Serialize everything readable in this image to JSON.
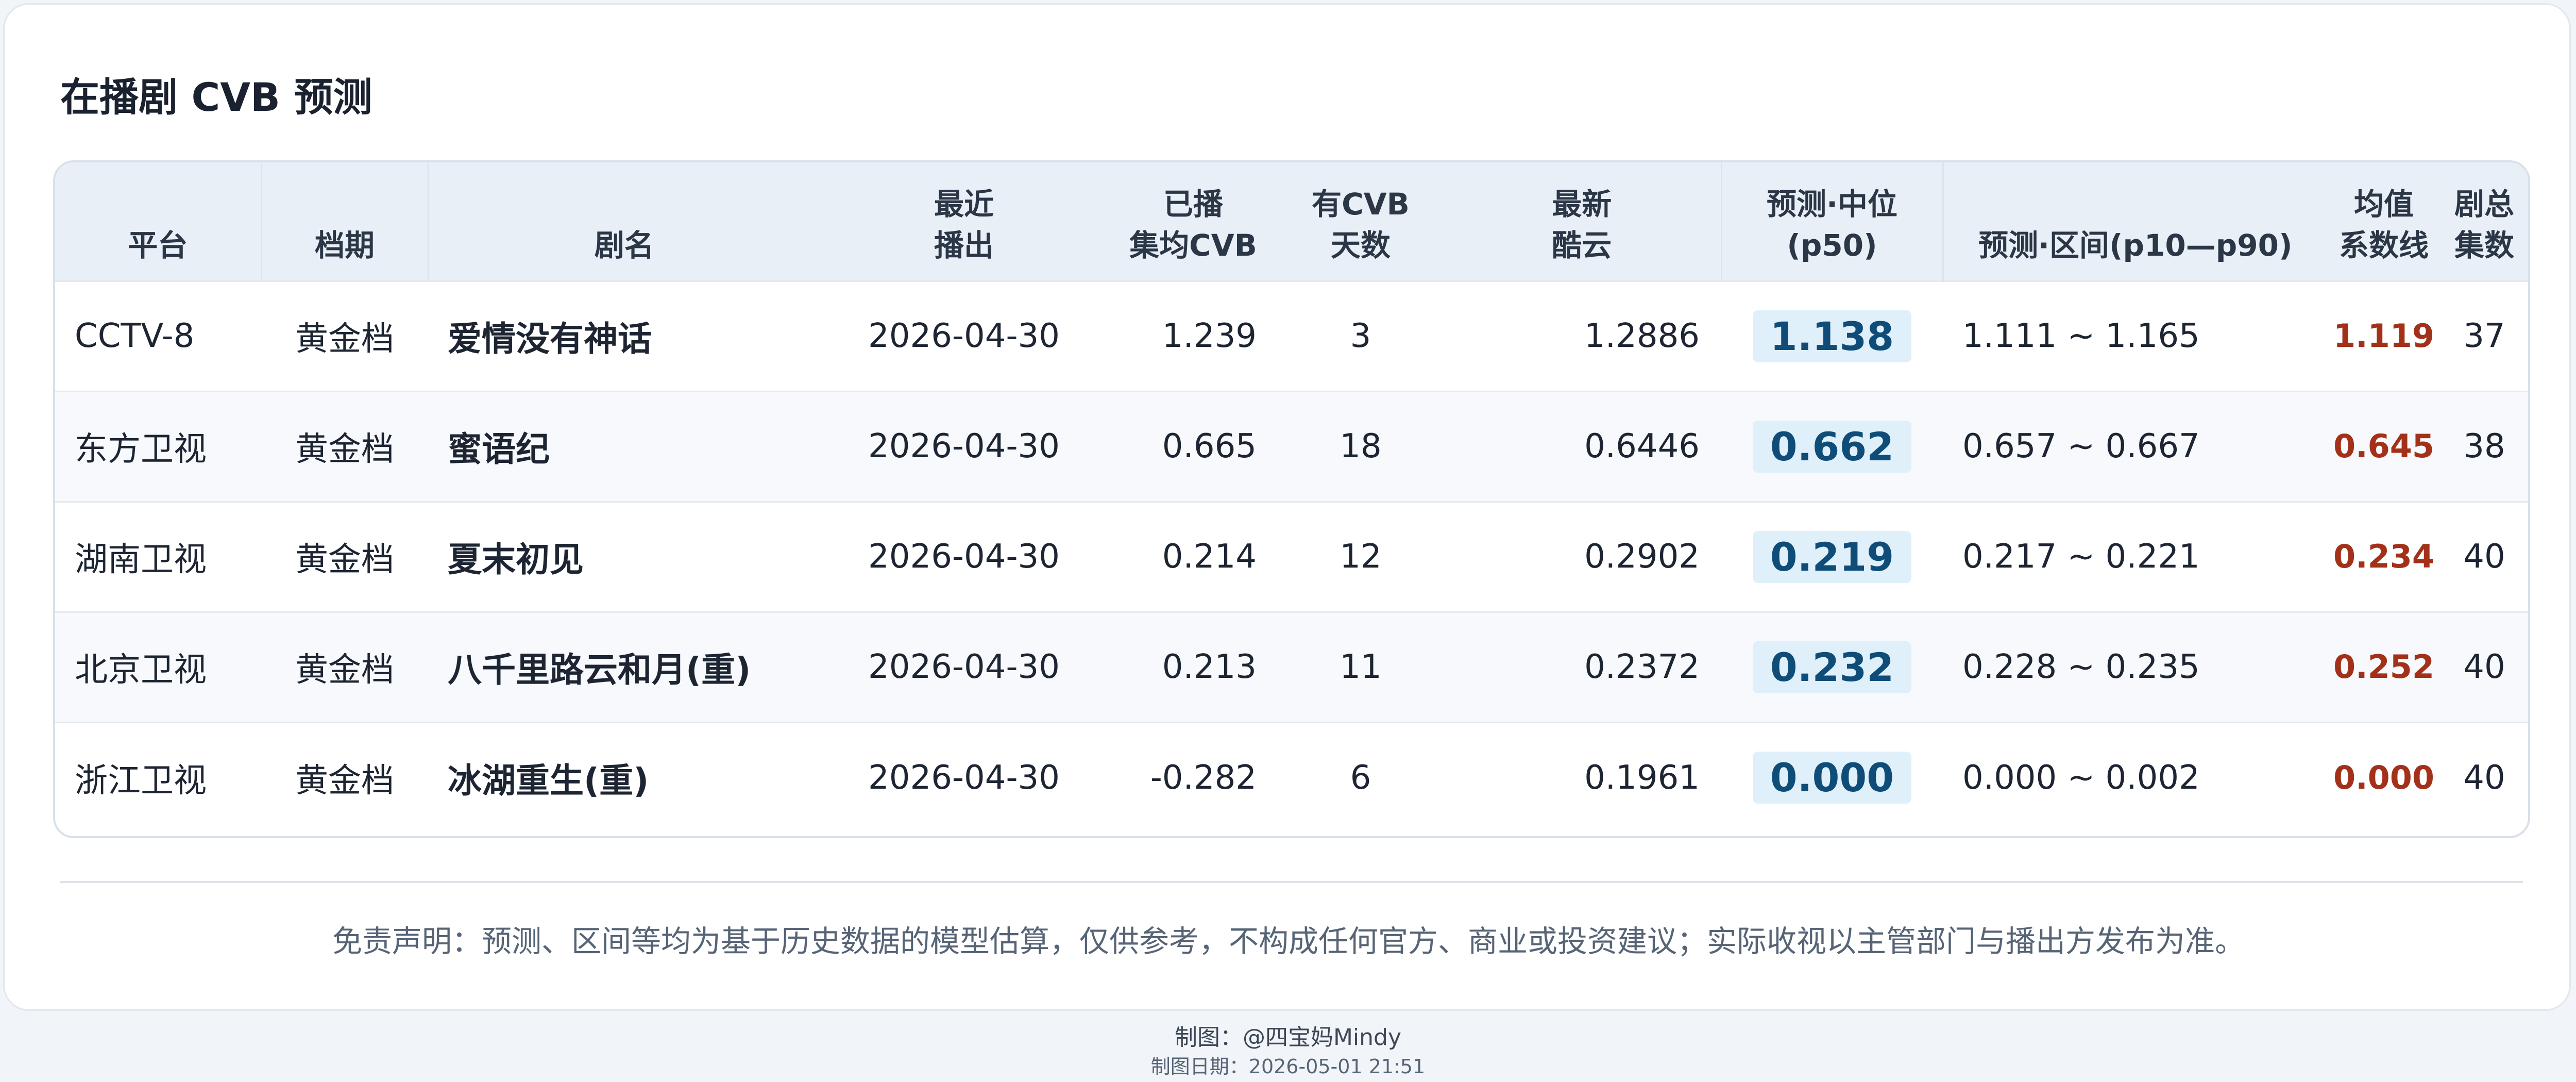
{
  "title": "在播剧 CVB 预测",
  "table": {
    "headers": [
      {
        "line1": "",
        "line2": "平台"
      },
      {
        "line1": "",
        "line2": "档期"
      },
      {
        "line1": "",
        "line2": "剧名"
      },
      {
        "line1": "最近",
        "line2": "播出"
      },
      {
        "line1": "已播",
        "line2": "集均CVB"
      },
      {
        "line1": "有CVB",
        "line2": "天数"
      },
      {
        "line1": "最新",
        "line2": "酷云"
      },
      {
        "line1": "预测·中位",
        "line2": "(p50)"
      },
      {
        "line1": "",
        "line2": "预测·区间(p10—p90)"
      },
      {
        "line1": "均值",
        "line2": "系数线"
      },
      {
        "line1": "剧总",
        "line2": "集数"
      }
    ],
    "rows": [
      {
        "platform": "CCTV-8",
        "slot": "黄金档",
        "show": "爱情没有神话",
        "last_aired": "2026-04-30",
        "avg_cvb": "1.239",
        "cvb_days": "3",
        "kuyun": "1.2886",
        "p50": "1.138",
        "range": "1.111 ~ 1.165",
        "mean_line": "1.119",
        "episodes": "37"
      },
      {
        "platform": "东方卫视",
        "slot": "黄金档",
        "show": "蜜语纪",
        "last_aired": "2026-04-30",
        "avg_cvb": "0.665",
        "cvb_days": "18",
        "kuyun": "0.6446",
        "p50": "0.662",
        "range": "0.657 ~ 0.667",
        "mean_line": "0.645",
        "episodes": "38"
      },
      {
        "platform": "湖南卫视",
        "slot": "黄金档",
        "show": "夏末初见",
        "last_aired": "2026-04-30",
        "avg_cvb": "0.214",
        "cvb_days": "12",
        "kuyun": "0.2902",
        "p50": "0.219",
        "range": "0.217 ~ 0.221",
        "mean_line": "0.234",
        "episodes": "40"
      },
      {
        "platform": "北京卫视",
        "slot": "黄金档",
        "show": "八千里路云和月(重)",
        "last_aired": "2026-04-30",
        "avg_cvb": "0.213",
        "cvb_days": "11",
        "kuyun": "0.2372",
        "p50": "0.232",
        "range": "0.228 ~ 0.235",
        "mean_line": "0.252",
        "episodes": "40"
      },
      {
        "platform": "浙江卫视",
        "slot": "黄金档",
        "show": "冰湖重生(重)",
        "last_aired": "2026-04-30",
        "avg_cvb": "-0.282",
        "cvb_days": "6",
        "kuyun": "0.1961",
        "p50": "0.000",
        "range": "0.000 ~ 0.002",
        "mean_line": "0.000",
        "episodes": "40"
      }
    ]
  },
  "disclaimer": "免责声明：预测、区间等均为基于历史数据的模型估算，仅供参考，不构成任何官方、商业或投资建议；实际收视以主管部门与播出方发布为准。",
  "footer": {
    "author": "制图：@四宝妈Mindy",
    "date": "制图日期：2026-05-01 21:51"
  },
  "colors": {
    "p50_bg": "#dff0fb",
    "p50_text": "#0f4d78",
    "mean_line_text": "#a3311a",
    "header_bg": "#e9eff6"
  }
}
